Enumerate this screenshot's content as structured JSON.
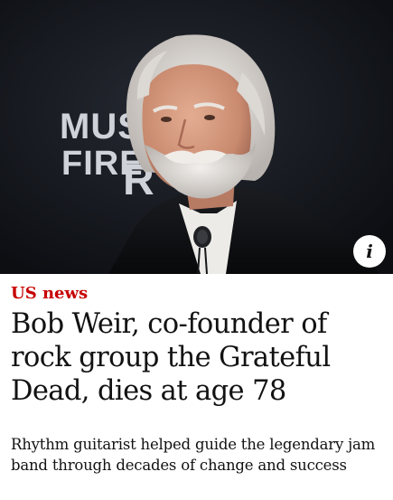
{
  "image": {
    "backdrop_text": "MUSIC FIRE R",
    "backdrop_line_1": "MUSI",
    "backdrop_line_2": "FIRE",
    "backdrop_letter": "R",
    "info_icon": "info-icon",
    "info_glyph": "i"
  },
  "article": {
    "section": "US news",
    "headline": "Bob Weir, co-founder of rock group the Grateful Dead, dies at age 78",
    "standfirst": "Rhythm guitarist helped guide the legendary jam band through decades of change and success"
  },
  "colors": {
    "section_red": "#c70000",
    "text": "#121212",
    "background": "#ffffff",
    "photo_backdrop": "#121419"
  }
}
